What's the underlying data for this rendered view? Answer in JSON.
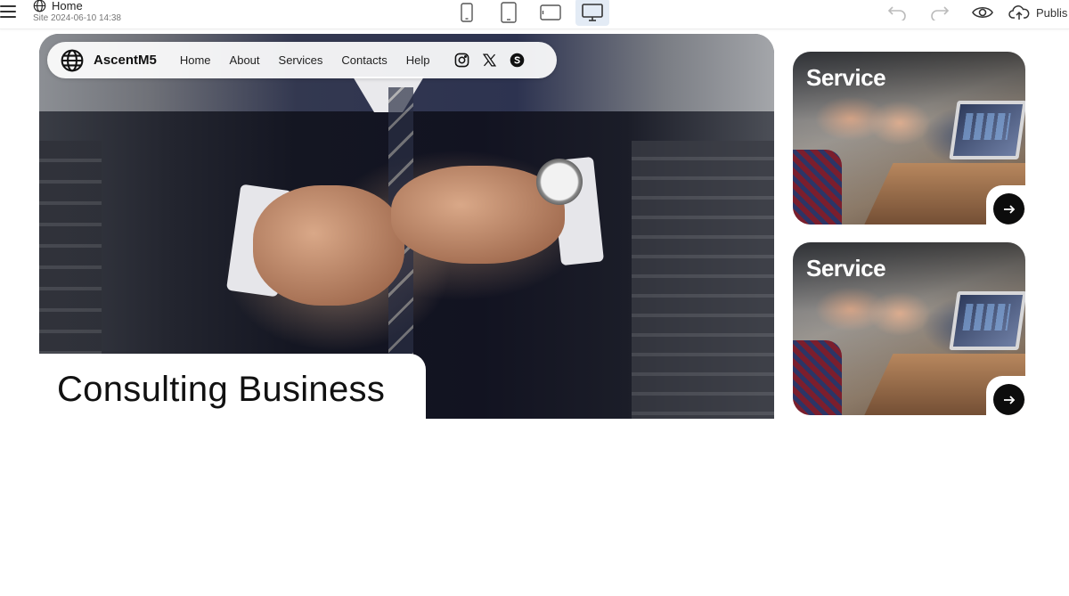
{
  "editor": {
    "page_name": "Home",
    "site_info": "Site 2024-06-10 14:38",
    "devices": [
      "mobile-portrait",
      "tablet-portrait",
      "tablet-landscape",
      "desktop"
    ],
    "active_device": "desktop",
    "publish_label": "Publis"
  },
  "site": {
    "brand": "AscentM5",
    "nav": [
      "Home",
      "About",
      "Services",
      "Contacts",
      "Help"
    ],
    "socials": [
      "instagram-icon",
      "x-twitter-icon",
      "skype-icon"
    ],
    "hero_title": "Consulting Business"
  },
  "services": [
    {
      "title": "Service"
    },
    {
      "title": "Service"
    }
  ],
  "colors": {
    "active_device_bg": "#e3ebf5",
    "arrow_button": "#0c0c0c",
    "card_title": "#ffffff"
  }
}
